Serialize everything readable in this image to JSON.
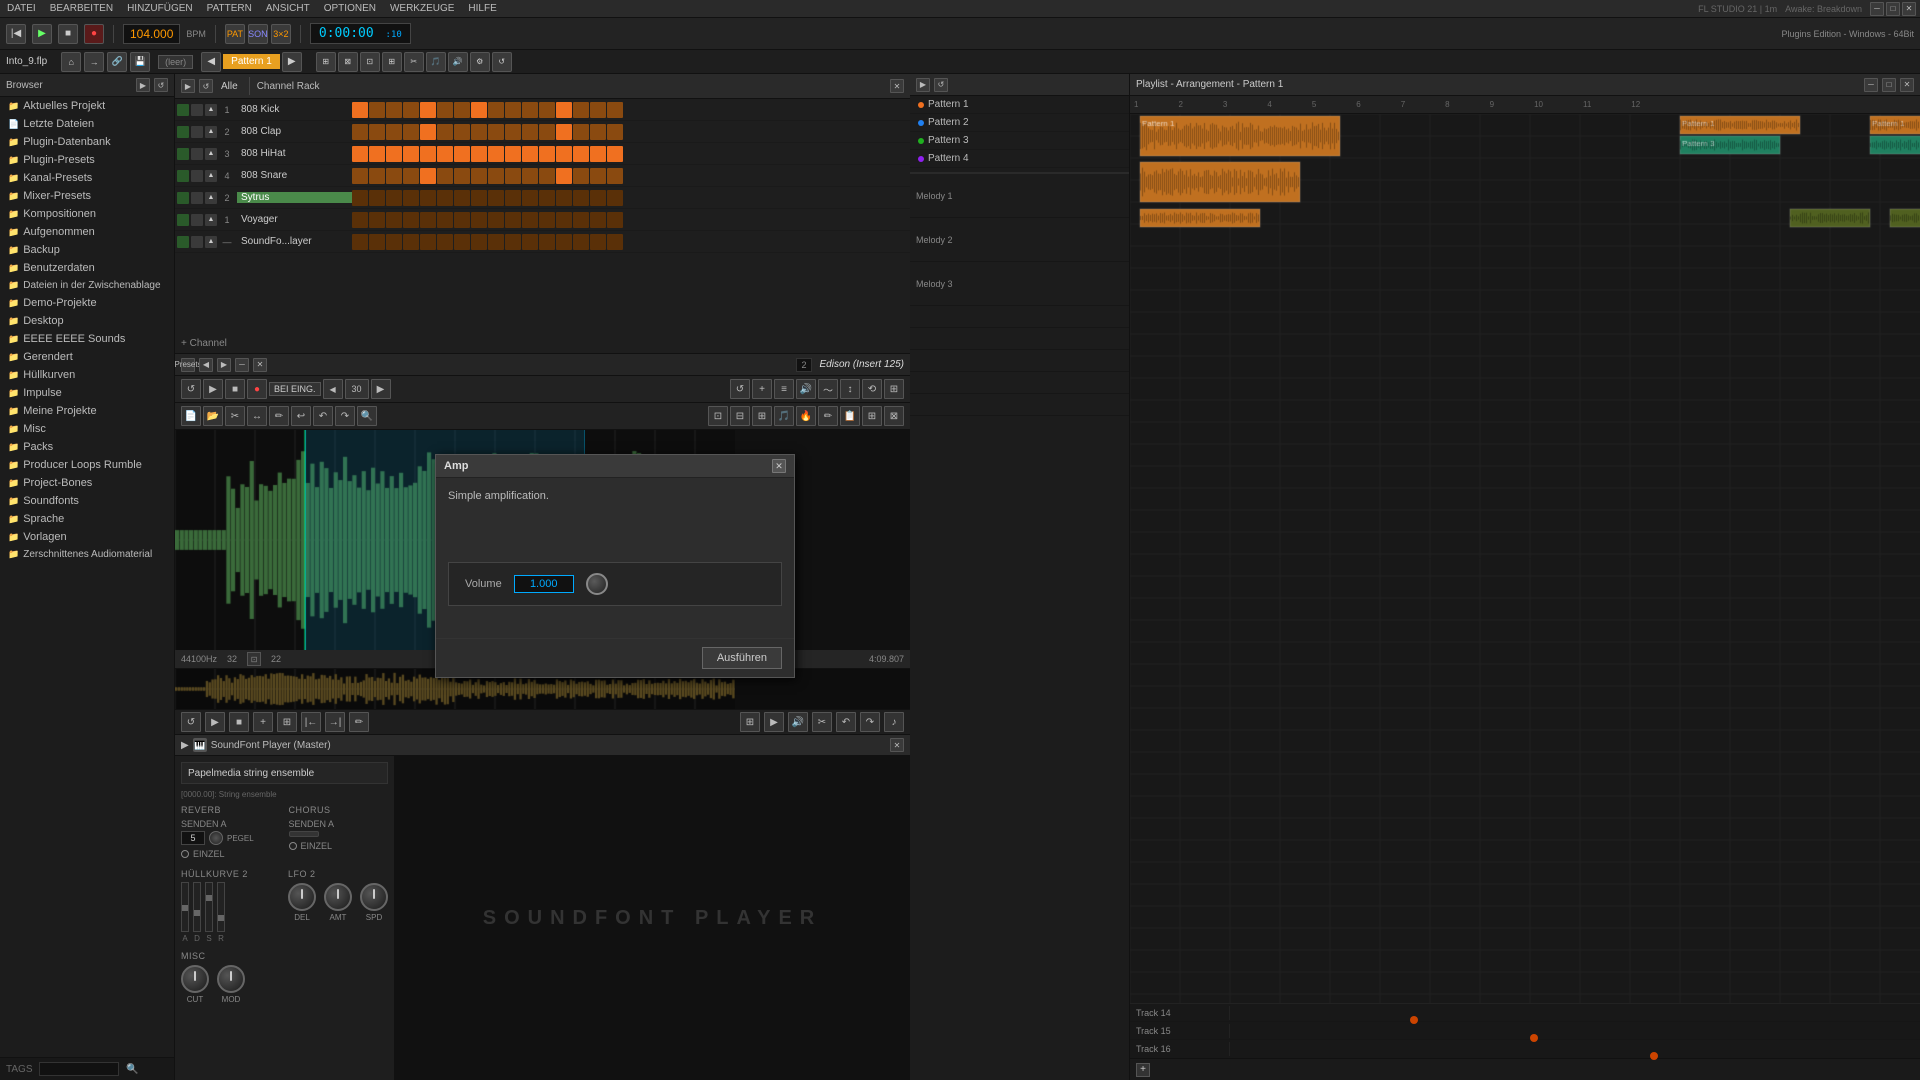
{
  "app": {
    "title": "FL STUDIO 21 | 1m",
    "subtitle": "Awake: Breakdown",
    "info": "Plugins Edition - Windows - 64Bit"
  },
  "menu": {
    "items": [
      "DATEI",
      "BEARBEITEN",
      "HINZUFÜGEN",
      "PATTERN",
      "ANSICHT",
      "OPTIONEN",
      "WERKZEUGE",
      "HILFE"
    ]
  },
  "transport": {
    "bpm": "104.000",
    "time": "0:00:00",
    "beats": "10",
    "pattern_label": "Pattern 1"
  },
  "file": {
    "name": "Into_9.flp"
  },
  "sidebar": {
    "header": "Browser",
    "items": [
      {
        "label": "Aktuelles Projekt",
        "icon": "📁"
      },
      {
        "label": "Letzte Dateien",
        "icon": "📄"
      },
      {
        "label": "Plugin-Datenbank",
        "icon": "🔌"
      },
      {
        "label": "Plugin-Presets",
        "icon": "🎛"
      },
      {
        "label": "Kanal-Presets",
        "icon": "📻"
      },
      {
        "label": "Mixer-Presets",
        "icon": "🎚"
      },
      {
        "label": "Kompositionen",
        "icon": "🎵"
      },
      {
        "label": "Aufgenommen",
        "icon": "🎙"
      },
      {
        "label": "Backup",
        "icon": "💾"
      },
      {
        "label": "Benutzerdaten",
        "icon": "👤"
      },
      {
        "label": "Dateien in der Zwischenablage",
        "icon": "📋"
      },
      {
        "label": "Demo-Projekte",
        "icon": "🎨"
      },
      {
        "label": "Desktop",
        "icon": "🖥"
      },
      {
        "label": "EEEE EEEE Sounds",
        "icon": "🔊"
      },
      {
        "label": "Gerendert",
        "icon": "🎞"
      },
      {
        "label": "Hüllkurven",
        "icon": "📈"
      },
      {
        "label": "Impulse",
        "icon": "⚡"
      },
      {
        "label": "Meine Projekte",
        "icon": "📂"
      },
      {
        "label": "Misc",
        "icon": "📦"
      },
      {
        "label": "Packs",
        "icon": "📦"
      },
      {
        "label": "Producer Loops Rumble",
        "icon": "🎵"
      },
      {
        "label": "Project-Bones",
        "icon": "🦴"
      },
      {
        "label": "Soundfonts",
        "icon": "🎹"
      },
      {
        "label": "Sprache",
        "icon": "💬"
      },
      {
        "label": "Vorlagen",
        "icon": "📑"
      },
      {
        "label": "Zerschnittenes Audiomaterial",
        "icon": "✂"
      }
    ],
    "tags_label": "TAGS"
  },
  "channel_rack": {
    "title": "Channel Rack",
    "filter": "Alle",
    "channels": [
      {
        "num": 1,
        "name": "808 Kick",
        "highlight": false
      },
      {
        "num": 2,
        "name": "808 Clap",
        "highlight": false
      },
      {
        "num": 3,
        "name": "808 HiHat",
        "highlight": false
      },
      {
        "num": 4,
        "name": "808 Snare",
        "highlight": false
      },
      {
        "num": 2,
        "name": "Sytrus",
        "highlight": true
      },
      {
        "num": 1,
        "name": "Voyager",
        "highlight": false
      },
      {
        "num": "-",
        "name": "SoundFo...layer",
        "highlight": false
      }
    ]
  },
  "patterns": {
    "items": [
      {
        "label": "Pattern 1",
        "color": "orange"
      },
      {
        "label": "Pattern 2",
        "color": "blue"
      },
      {
        "label": "Pattern 3",
        "color": "green"
      },
      {
        "label": "Pattern 4",
        "color": "purple"
      }
    ]
  },
  "playlist": {
    "title": "Playlist - Arrangement - Pattern 1",
    "tracks": [
      {
        "name": "Melody 1"
      },
      {
        "name": "Melody 2"
      },
      {
        "name": "Melody 3"
      },
      {
        "name": ""
      },
      {
        "name": ""
      },
      {
        "name": ""
      },
      {
        "name": ""
      },
      {
        "name": ""
      },
      {
        "name": ""
      },
      {
        "name": ""
      },
      {
        "name": ""
      },
      {
        "name": ""
      },
      {
        "name": "Track 14"
      },
      {
        "name": "Track 15"
      },
      {
        "name": "Track 16"
      }
    ]
  },
  "edison": {
    "title": "Edison (Insert 125)",
    "sample_rate": "44100Hz",
    "bit_depth": "32",
    "duration": "4:09.807",
    "zoom": "22"
  },
  "amp_dialog": {
    "title": "Amp",
    "description": "Simple amplification.",
    "volume_label": "Volume",
    "volume_value": "1.000",
    "run_button": "Ausführen"
  },
  "soundfont": {
    "title": "SoundFont Player (Master)",
    "preset_name": "Papelmedia string ensemble",
    "patch_name": "[0000.00]: String ensemble",
    "reverb_label": "REVERB",
    "chorus_label": "CHORUS",
    "senden_a_label": "SENDEN A",
    "senden_a_value": "5",
    "pegel_label": "PEGEL",
    "einzel_label": "EINZEL",
    "hullkurve_label": "HÜLLKURVE 2",
    "lfo_label": "LFO 2",
    "misc_label": "MISC",
    "knobs": {
      "del": "DEL",
      "amt": "AMT",
      "spd": "SPD",
      "cut": "CUT",
      "mod": "MOD"
    }
  },
  "time_display": {
    "time": "0:00:00",
    "time_label": "10"
  },
  "icons": {
    "play": "▶",
    "stop": "■",
    "record": "●",
    "loop": "↺",
    "close": "✕",
    "folder": "📁",
    "arrow_right": "▶",
    "arrow_left": "◀",
    "settings": "⚙",
    "plus": "+",
    "minus": "-"
  }
}
